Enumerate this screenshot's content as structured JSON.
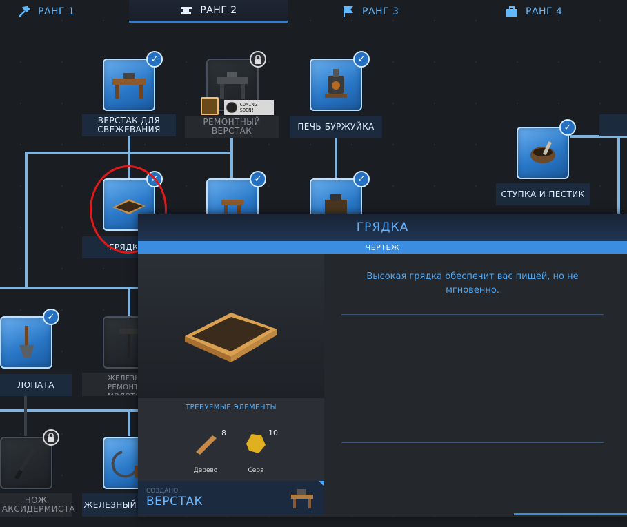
{
  "ranks": [
    {
      "label": "РАНГ 1",
      "icon": "rank1-hammer-icon"
    },
    {
      "label": "РАНГ 2",
      "icon": "rank2-anvil-icon",
      "active": true
    },
    {
      "label": "РАНГ 3",
      "icon": "rank3-flag-icon"
    },
    {
      "label": "РАНГ 4",
      "icon": "rank4-toolbox-icon"
    }
  ],
  "nodes": {
    "skinning_bench": {
      "label": "ВЕРСТАК ДЛЯ СВЕЖЕВАНИЯ",
      "status": "unlocked",
      "icon": "skinning-bench-icon"
    },
    "repair_bench": {
      "label": "РЕМОНТНЫЙ ВЕРСТАК",
      "status": "locked",
      "icon": "repair-bench-icon",
      "badge": "COMING SOON!"
    },
    "stove": {
      "label": "ПЕЧЬ-БУРЖУЙКА",
      "status": "unlocked",
      "icon": "stove-icon"
    },
    "mortar": {
      "label": "СТУПКА И ПЕСТИК",
      "status": "unlocked",
      "icon": "mortar-pestle-icon"
    },
    "garden_bed": {
      "label": "ГРЯДКА",
      "status": "unlocked",
      "icon": "garden-bed-icon",
      "selected": true
    },
    "shovel": {
      "label": "ЛОПАТА",
      "status": "unlocked",
      "icon": "shovel-icon"
    },
    "iron_hammer": {
      "label": "ЖЕЛЕЗНЫЙ РЕМОНТНЫЙ МОЛОТОК",
      "status": "locked",
      "icon": "iron-hammer-icon"
    },
    "knife": {
      "label": "НОЖ ТАКСИДЕРМИСТА",
      "status": "locked",
      "icon": "taxidermy-knife-icon"
    },
    "iron_sickle": {
      "label": "ЖЕЛЕЗНЫЙ",
      "status": "unlocked",
      "icon": "sickle-icon"
    }
  },
  "popup": {
    "title": "ГРЯДКА",
    "subtitle": "ЧЕРТЕЖ",
    "description": "Высокая грядка обеспечит вас пищей, но не мгновенно.",
    "requirements_title": "ТРЕБУЕМЫЕ ЭЛЕМЕНТЫ",
    "requirements": [
      {
        "name": "Дерево",
        "count": "8",
        "icon": "wood-icon"
      },
      {
        "name": "Сера",
        "count": "10",
        "icon": "sulfur-icon"
      }
    ],
    "crafted_label": "СОЗДАНО:",
    "crafted_value": "ВЕРСТАК"
  },
  "colors": {
    "accent": "#3a8de0",
    "node_blue": "#2a78c8",
    "selection_circle": "#e01a1a",
    "text_blue": "#4fa7f2"
  }
}
